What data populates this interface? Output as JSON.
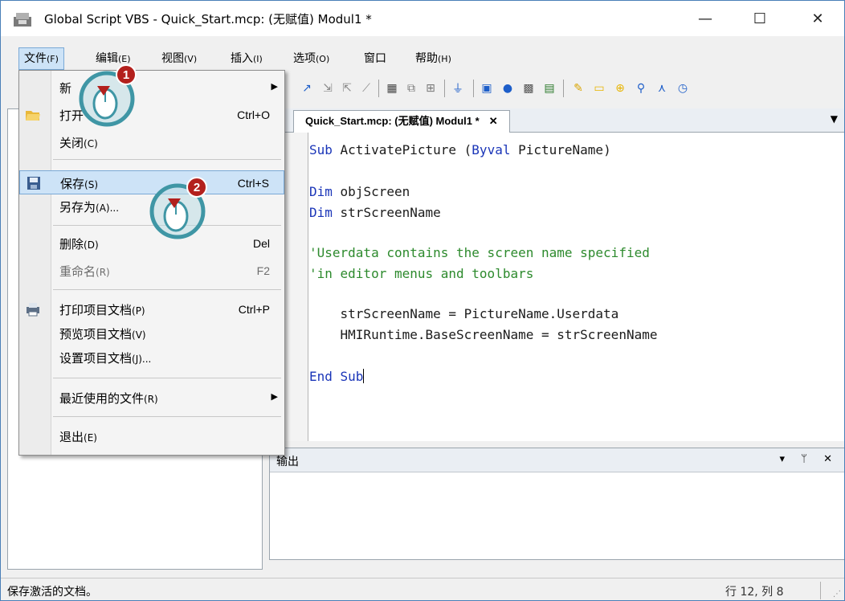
{
  "window": {
    "title": "Global Script VBS - Quick_Start.mcp: (无赋值) Modul1 *",
    "minimize": "—",
    "maximize": "☐",
    "close": "✕"
  },
  "menubar": {
    "items": [
      {
        "label": "文件",
        "accel": "(F)"
      },
      {
        "label": "编辑",
        "accel": "(E)"
      },
      {
        "label": "视图",
        "accel": "(V)"
      },
      {
        "label": "插入",
        "accel": "(I)"
      },
      {
        "label": "选项",
        "accel": "(O)"
      },
      {
        "label": "窗口",
        "accel": ""
      },
      {
        "label": "帮助",
        "accel": "(H)"
      }
    ]
  },
  "file_menu": {
    "items": [
      {
        "label": "新",
        "accel": "",
        "shortcut": "",
        "submenu": true
      },
      {
        "label": "打开",
        "accel": "",
        "shortcut": "Ctrl+O",
        "icon": "folder-open-icon"
      },
      {
        "label": "关闭",
        "accel": "(C)",
        "shortcut": ""
      },
      {
        "label": "保存",
        "accel": "(S)",
        "shortcut": "Ctrl+S",
        "icon": "save-icon",
        "highlighted": true
      },
      {
        "label": "另存为",
        "accel": "(A)...",
        "shortcut": ""
      },
      {
        "label": "删除",
        "accel": "(D)",
        "shortcut": "Del"
      },
      {
        "label": "重命名",
        "accel": "(R)",
        "shortcut": "F2",
        "disabled": true
      },
      {
        "label": "打印项目文档",
        "accel": "(P)",
        "shortcut": "Ctrl+P",
        "icon": "printer-icon"
      },
      {
        "label": "预览项目文档",
        "accel": "(V)",
        "shortcut": ""
      },
      {
        "label": "设置项目文档",
        "accel": "(J)...",
        "shortcut": ""
      },
      {
        "label": "最近使用的文件",
        "accel": "(R)",
        "shortcut": "",
        "submenu": true
      },
      {
        "label": "退出",
        "accel": "(E)",
        "shortcut": ""
      }
    ]
  },
  "callouts": [
    {
      "number": "1"
    },
    {
      "number": "2"
    }
  ],
  "editor": {
    "tab_label": "Quick_Start.mcp: (无赋值) Modul1 *",
    "tab_close": "✕",
    "code": {
      "line1_kw": "Sub",
      "line1_rest": " ActivatePicture (",
      "line1_kw2": "Byval",
      "line1_rest2": " PictureName)",
      "line2_kw": "Dim",
      "line2_rest": " objScreen",
      "line3_kw": "Dim",
      "line3_rest": " strScreenName",
      "line4": "'Userdata contains the screen name specified",
      "line5": "'in editor menus and toolbars",
      "line6": "    strScreenName = PictureName.Userdata",
      "line7": "    HMIRuntime.BaseScreenName = strScreenName",
      "line8_kw": "End Sub"
    }
  },
  "output": {
    "title": "输出",
    "controls": "▾ ᛘ ✕"
  },
  "statusbar": {
    "message": "保存激活的文档。",
    "position": "行 12, 列 8"
  },
  "colors": {
    "keyword": "#1a35b8",
    "comment": "#2d8a2d",
    "callout_teal": "#3f96a5",
    "callout_badge": "#b3201d"
  }
}
